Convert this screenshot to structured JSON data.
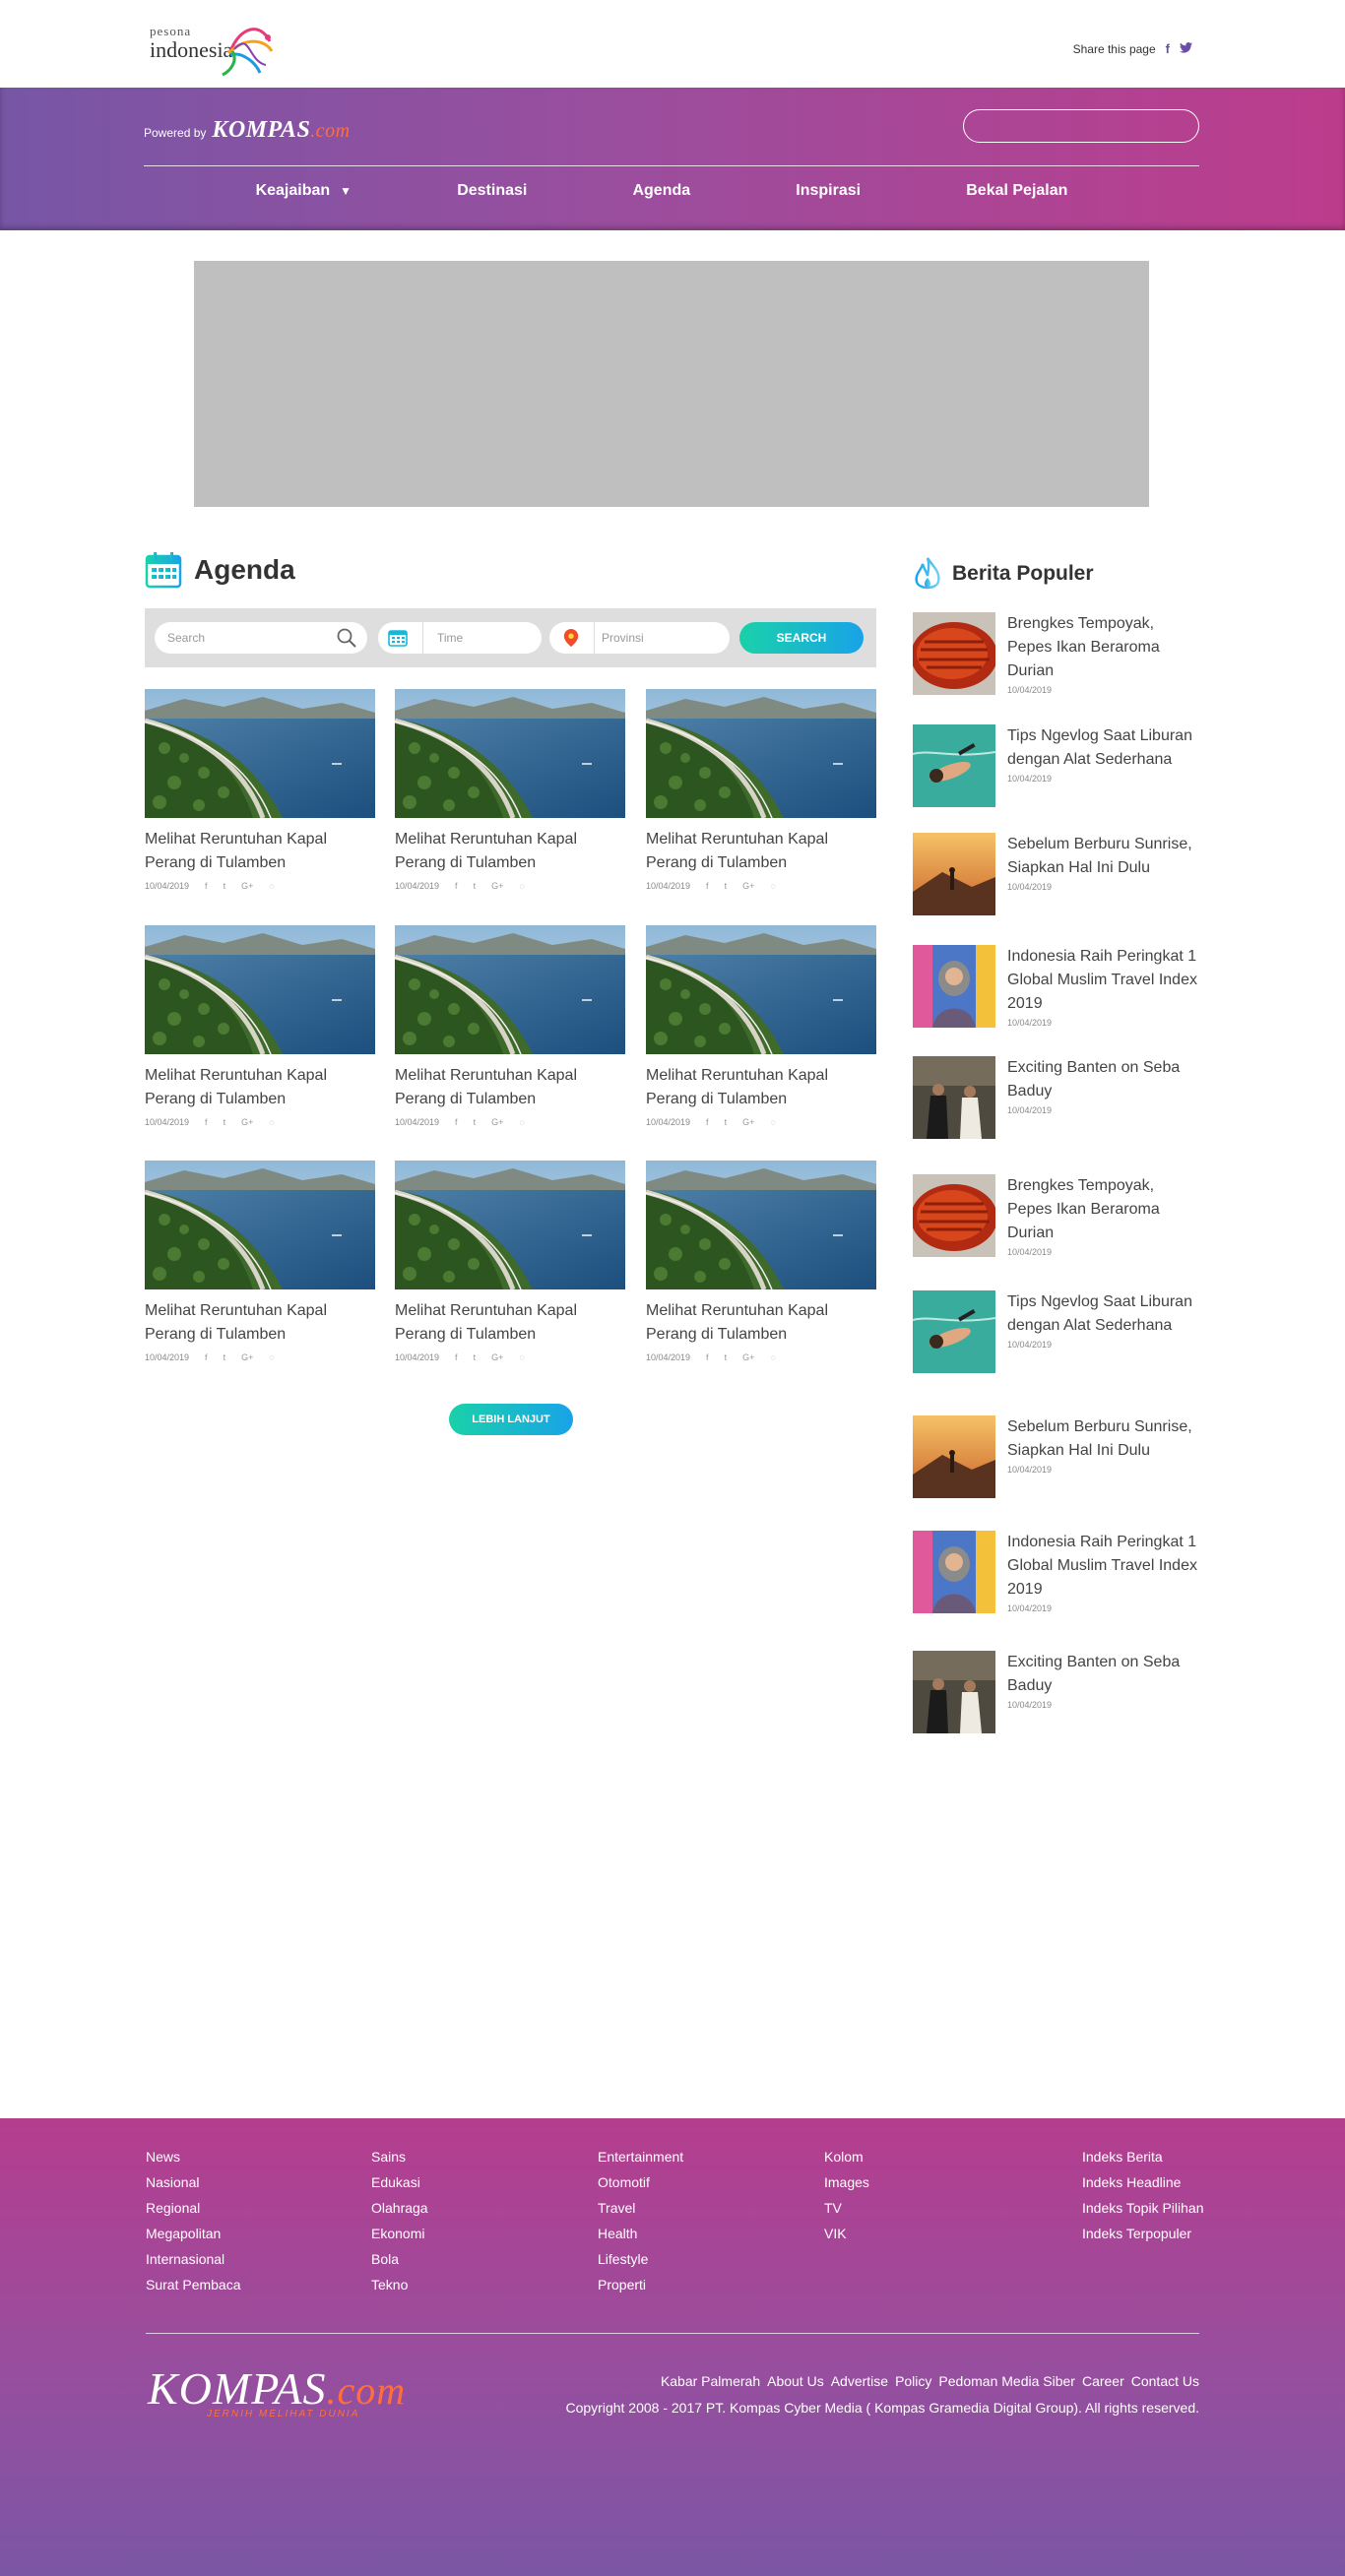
{
  "header": {
    "logo": {
      "top": "pesona",
      "main": "indonesia"
    },
    "share_label": "Share this page",
    "share_icons": [
      "facebook-icon",
      "twitter-icon"
    ]
  },
  "topnav": {
    "powered_by": "Powered by",
    "brand": "KOMPAS",
    "brand_suffix": ".com",
    "search_placeholder": "",
    "items": [
      {
        "label": "Keajaiban",
        "has_dropdown": true
      },
      {
        "label": "Destinasi"
      },
      {
        "label": "Agenda"
      },
      {
        "label": "Inspirasi"
      },
      {
        "label": "Bekal Pejalan"
      }
    ]
  },
  "agenda": {
    "title": "Agenda",
    "filters": {
      "search_placeholder": "Search",
      "time_placeholder": "Time",
      "province_placeholder": "Provinsi",
      "search_button": "SEARCH"
    },
    "cards": [
      {
        "title": "Melihat Reruntuhan Kapal Perang di Tulamben",
        "date": "10/04/2019"
      },
      {
        "title": "Melihat Reruntuhan Kapal Perang di Tulamben",
        "date": "10/04/2019"
      },
      {
        "title": "Melihat Reruntuhan Kapal Perang di Tulamben",
        "date": "10/04/2019"
      },
      {
        "title": "Melihat Reruntuhan Kapal Perang di Tulamben",
        "date": "10/04/2019"
      },
      {
        "title": "Melihat Reruntuhan Kapal Perang di Tulamben",
        "date": "10/04/2019"
      },
      {
        "title": "Melihat Reruntuhan Kapal Perang di Tulamben",
        "date": "10/04/2019"
      },
      {
        "title": "Melihat Reruntuhan Kapal Perang di Tulamben",
        "date": "10/04/2019"
      },
      {
        "title": "Melihat Reruntuhan Kapal Perang di Tulamben",
        "date": "10/04/2019"
      },
      {
        "title": "Melihat Reruntuhan Kapal Perang di Tulamben",
        "date": "10/04/2019"
      }
    ],
    "share_glyphs": [
      "f",
      "t",
      "G+",
      "w"
    ],
    "more_button": "LEBIH LANJUT"
  },
  "popular": {
    "title": "Berita Populer",
    "items": [
      {
        "title": "Brengkes Tempoyak, Pepes Ikan Beraroma Durian",
        "date": "10/04/2019",
        "thumb": "food"
      },
      {
        "title": "Tips Ngevlog Saat Liburan dengan Alat Sederhana",
        "date": "10/04/2019",
        "thumb": "swim"
      },
      {
        "title": "Sebelum Berburu Sunrise, Siapkan Hal Ini Dulu",
        "date": "10/04/2019",
        "thumb": "sunrise"
      },
      {
        "title": "Indonesia Raih Peringkat 1 Global Muslim Travel Index 2019",
        "date": "10/04/2019",
        "thumb": "muslim"
      },
      {
        "title": "Exciting Banten on Seba Baduy",
        "date": "10/04/2019",
        "thumb": "baduy"
      },
      {
        "title": "Brengkes Tempoyak, Pepes Ikan Beraroma Durian",
        "date": "10/04/2019",
        "thumb": "food"
      },
      {
        "title": "Tips Ngevlog Saat Liburan dengan Alat Sederhana",
        "date": "10/04/2019",
        "thumb": "swim"
      },
      {
        "title": "Sebelum Berburu Sunrise, Siapkan Hal Ini Dulu",
        "date": "10/04/2019",
        "thumb": "sunrise"
      },
      {
        "title": "Indonesia Raih Peringkat 1 Global Muslim Travel Index 2019",
        "date": "10/04/2019",
        "thumb": "muslim"
      },
      {
        "title": "Exciting Banten on Seba Baduy",
        "date": "10/04/2019",
        "thumb": "baduy"
      }
    ]
  },
  "footer": {
    "columns": [
      [
        "News",
        "Nasional",
        "Regional",
        "Megapolitan",
        "Internasional",
        "Surat Pembaca"
      ],
      [
        "Sains",
        "Edukasi",
        "Olahraga",
        "Ekonomi",
        "Bola",
        "Tekno"
      ],
      [
        "Entertainment",
        "Otomotif",
        "Travel",
        "Health",
        "Lifestyle",
        "Properti"
      ],
      [
        "Kolom",
        "Images",
        "TV",
        "VIK"
      ],
      [
        "Indeks Berita",
        "Indeks Headline",
        "Indeks Topik Pilihan",
        "Indeks Terpopuler"
      ]
    ],
    "brand": "KOMPAS",
    "brand_suffix": ".com",
    "tagline": "JERNIH MELIHAT DUNIA",
    "links": [
      "Kabar Palmerah",
      "About Us",
      "Advertise",
      "Policy",
      "Pedoman Media Siber",
      "Career",
      "Contact Us"
    ],
    "copyright": "Copyright 2008 - 2017 PT. Kompas Cyber Media ( Kompas Gramedia Digital Group). All rights reserved."
  },
  "colors": {
    "header_gradient": [
      "#7756a6",
      "#bd3c8c"
    ],
    "button_gradient": [
      "#1ad1a9",
      "#19a3e8"
    ],
    "ad_placeholder": "#c0bfc0"
  }
}
